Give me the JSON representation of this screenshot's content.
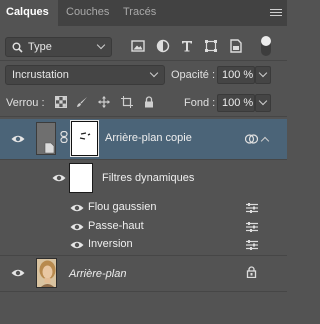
{
  "tabs": [
    {
      "label": "Calques",
      "active": true
    },
    {
      "label": "Couches",
      "active": false
    },
    {
      "label": "Tracés",
      "active": false
    }
  ],
  "filter": {
    "type_label": "Type",
    "icons": [
      "image-filter-icon",
      "adjustment-filter-icon",
      "type-filter-icon",
      "shape-filter-icon",
      "smart-object-filter-icon"
    ]
  },
  "blend": {
    "mode": "Incrustation",
    "opacity_label": "Opacité :",
    "opacity_value": "100 %"
  },
  "lock": {
    "label": "Verrou :",
    "fill_label": "Fond :",
    "fill_value": "100 %"
  },
  "layers": [
    {
      "name": "Arrière-plan copie",
      "selected": true,
      "type": "smart-object"
    },
    {
      "name": "Filtres dynamiques",
      "type": "smart-filters"
    },
    {
      "name": "Flou gaussien",
      "type": "filter"
    },
    {
      "name": "Passe-haut",
      "type": "filter"
    },
    {
      "name": "Inversion",
      "type": "filter"
    },
    {
      "name": "Arrière-plan",
      "type": "background",
      "locked": true
    }
  ],
  "colors": {
    "panel": "#535353",
    "tabbar": "#424242",
    "selected_row": "#4b6478"
  }
}
